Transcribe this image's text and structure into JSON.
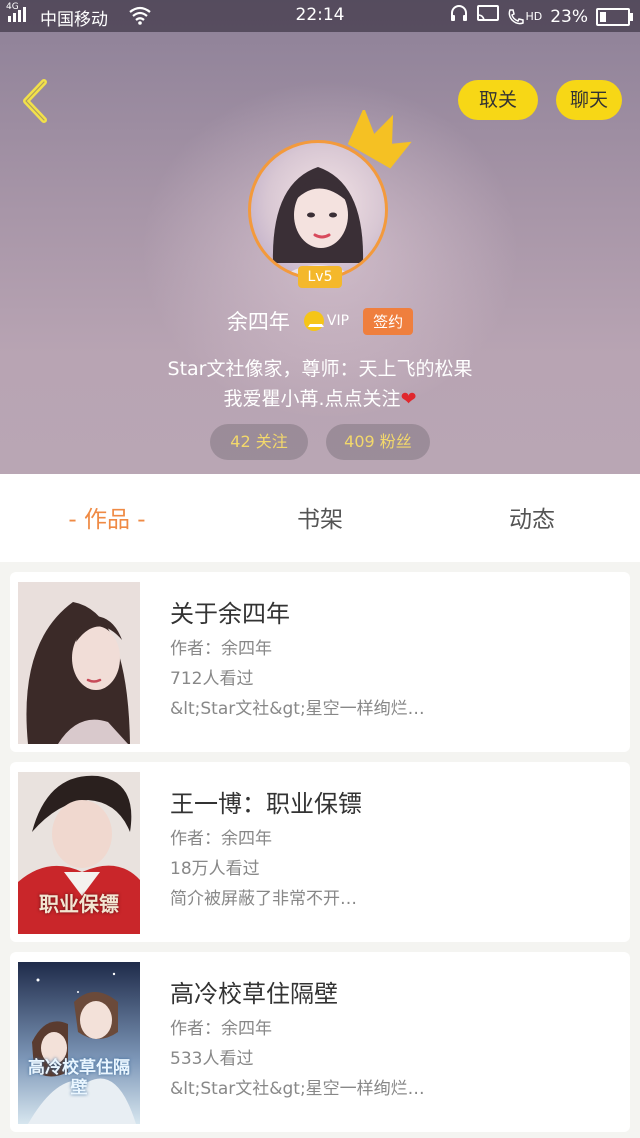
{
  "status_bar": {
    "network_tag": "4G",
    "carrier": "中国移动",
    "time": "22:14",
    "volte": "HD",
    "battery": "23%",
    "battery_level": 0.23
  },
  "header": {
    "unfollow_label": "取关",
    "chat_label": "聊天",
    "level": "Lv5",
    "username": "余四年",
    "vip_label": "VIP",
    "signed_label": "签约",
    "bio_line1": "Star文社像家，尊师：天上飞的松果",
    "bio_line2": "我爱瞿小苒.点点关注",
    "follow_stat": "42 关注",
    "fans_stat": "409 粉丝"
  },
  "tabs": [
    {
      "label": "-  作品  -"
    },
    {
      "label": "书架"
    },
    {
      "label": "动态"
    }
  ],
  "works": [
    {
      "title": "关于余四年",
      "author": "作者：余四年",
      "views": "712人看过",
      "desc": "&lt;Star文社&gt;星空一样绚烂…"
    },
    {
      "title": "王一博：职业保镖",
      "author": "作者：余四年",
      "views": "18万人看过",
      "desc": "简介被屏蔽了非常不开…",
      "cover_text": "职业保镖"
    },
    {
      "title": "高冷校草住隔壁",
      "author": "作者：余四年",
      "views": "533人看过",
      "desc": "&lt;Star文社&gt;星空一样绚烂…",
      "cover_text": "高冷校草住隔壁"
    }
  ],
  "colors": {
    "accent_yellow": "#f7d716",
    "accent_orange": "#ef8a44",
    "avatar_ring": "#f39a3c"
  }
}
